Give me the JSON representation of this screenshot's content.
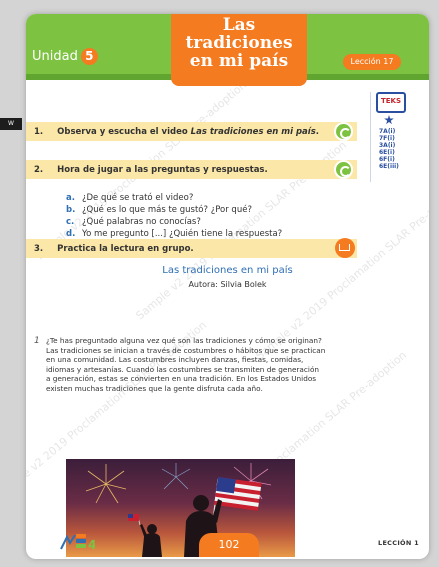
{
  "header": {
    "unidad_label": "Unidad",
    "unidad_number": "5",
    "title_line1": "Las",
    "title_line2": "tradiciones",
    "title_line3": "en mi país",
    "leccion": "Lección 17"
  },
  "teks": {
    "logo": "TEKS",
    "codes": [
      "7A(i)",
      "7F(i)",
      "3A(i)",
      "6E(i)",
      "6F(i)",
      "6E(iii)"
    ]
  },
  "instructions": [
    {
      "number": "1.",
      "text_prefix": "Observa y escucha el video ",
      "text_italic": "Las tradiciones en mi país",
      "text_suffix": "."
    },
    {
      "number": "2.",
      "text": "Hora de jugar a las preguntas y respuestas."
    },
    {
      "number": "3.",
      "text": "Practica la lectura en grupo."
    }
  ],
  "questions": [
    {
      "letter": "a.",
      "text": "¿De qué se trató el video?"
    },
    {
      "letter": "b.",
      "text": "¿Qué es lo que más te gustó? ¿Por qué?"
    },
    {
      "letter": "c.",
      "text": "¿Qué palabras no conocías?"
    },
    {
      "letter": "d.",
      "text": "Yo me pregunto [...] ¿Quién tiene la respuesta?"
    }
  ],
  "reading": {
    "title": "Las tradiciones en mi país",
    "author": "Autora: Silvia Bolek",
    "paragraph_number": "1",
    "lines": [
      "¿Te has preguntado alguna vez qué son las tradiciones y cómo se originan?",
      "Las tradiciones se inician a través de costumbres o hábitos que se practican",
      "en una comunidad. Las costumbres incluyen danzas, fiestas, comidas,",
      "idiomas y artesanías. Cuando las costumbres se transmiten de generación",
      "a generación, estas se convierten en una tradición. En los Estados Unidos",
      "existen muchas tradiciones que la gente disfruta cada año."
    ]
  },
  "footer": {
    "page_number": "102",
    "leccion_label": "LECCIÓN 1",
    "logo_text": "Lengua, ritmo y cultura",
    "logo_number": "4"
  },
  "left_tab": "W",
  "watermark": "Sample v2 2019 Proclamation SLAR Pre-adoption",
  "colors": {
    "header_green": "#7ec242",
    "accent_orange": "#f47b20",
    "bar_yellow": "#fbe7a8",
    "link_blue": "#2f6fb4"
  }
}
